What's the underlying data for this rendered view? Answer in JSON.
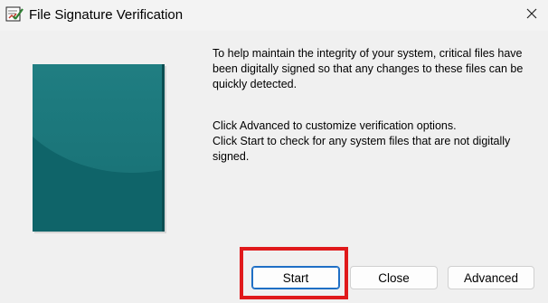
{
  "window": {
    "title": "File Signature Verification",
    "icons": {
      "app": "signature-check-icon",
      "close": "close-icon"
    }
  },
  "content": {
    "intro": "To help maintain the integrity of your system, critical files have been digitally signed so that any changes to these files can be quickly detected.",
    "advanced_hint": "Click Advanced to customize verification options.",
    "start_hint": "Click Start to check for any system files that are not digitally signed."
  },
  "buttons": {
    "start": "Start",
    "close": "Close",
    "advanced": "Advanced"
  },
  "colors": {
    "panel": "#0f6469",
    "focus_border": "#1f6fc5",
    "highlight": "#e0191b"
  }
}
